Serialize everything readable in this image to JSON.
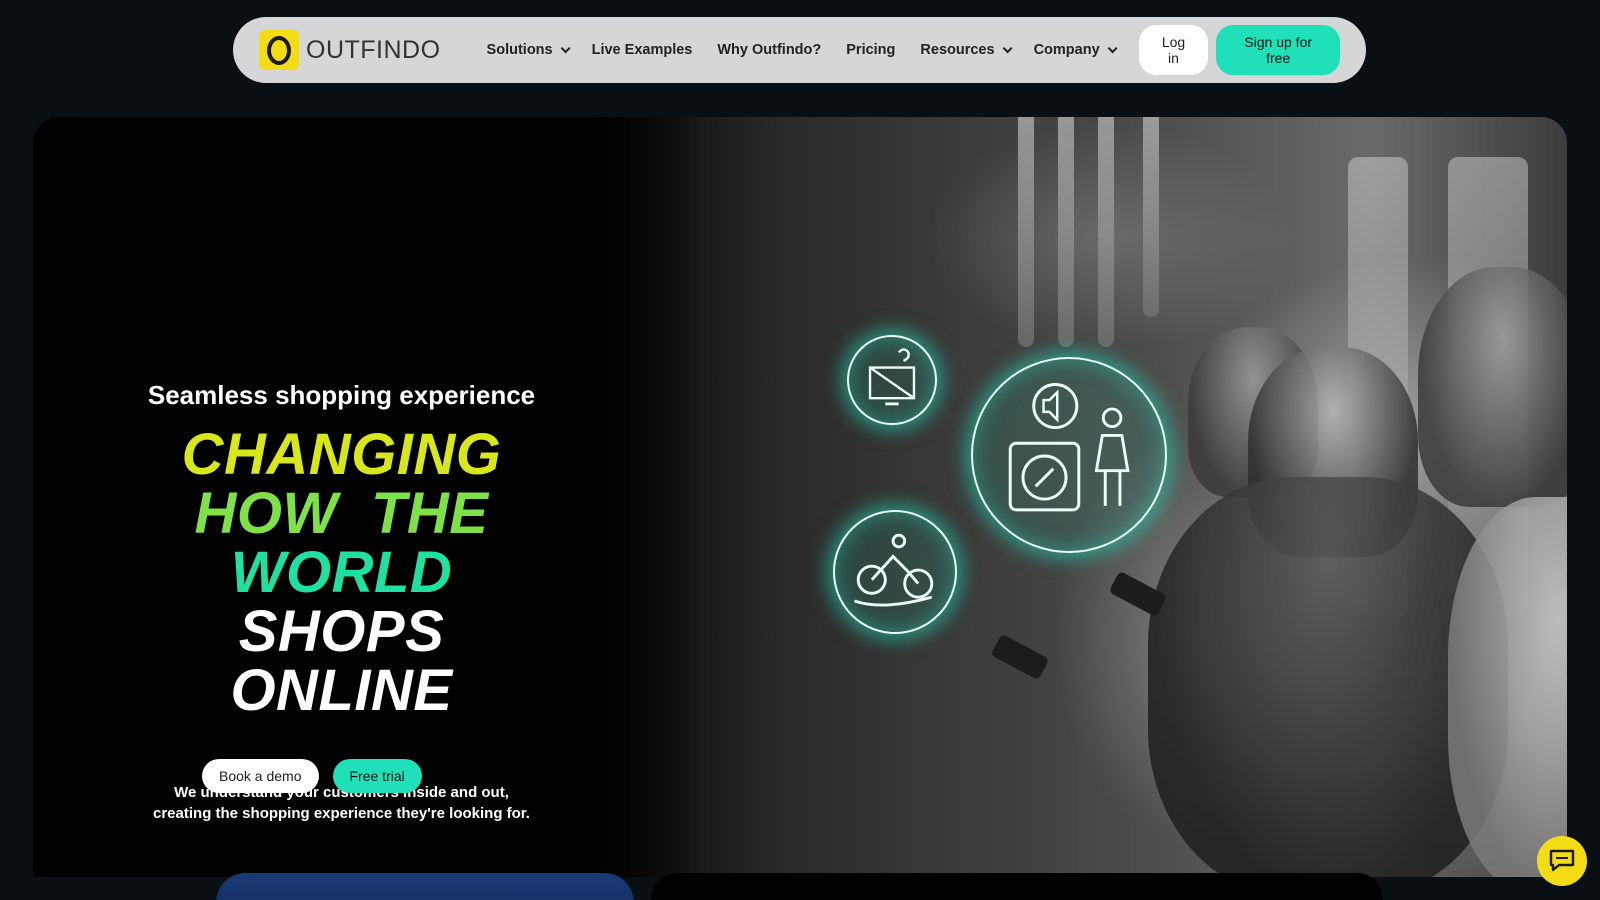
{
  "nav": {
    "logo_text": "OUTFINDO",
    "items": [
      {
        "label": "Solutions",
        "dropdown": true
      },
      {
        "label": "Live Examples",
        "dropdown": false
      },
      {
        "label": "Why Outfindo?",
        "dropdown": false
      },
      {
        "label": "Pricing",
        "dropdown": false
      },
      {
        "label": "Resources",
        "dropdown": true
      },
      {
        "label": "Company",
        "dropdown": true
      }
    ],
    "login_label": "Log in",
    "signup_label": "Sign up for free"
  },
  "hero": {
    "tagline": "Seamless shopping experience",
    "headline": [
      "CHANGING",
      "HOW  THE",
      "WORLD",
      "SHOPS",
      "ONLINE"
    ],
    "subtext_line1": "We understand your customers inside and out,",
    "subtext_line2": "creating the shopping experience they're looking for.",
    "demo_label": "Book a demo",
    "trial_label": "Free trial"
  },
  "colors": {
    "accent": "#1fe0b8",
    "brand_yellow": "#f3dc14",
    "headline_yellow": "#d8e61c",
    "headline_green": "#7fe04a",
    "headline_teal": "#1fe0a0"
  },
  "icons": [
    "monitor-question-icon",
    "mute-speaker-icon",
    "washing-machine-icon",
    "person-icon",
    "cyclist-icon",
    "chat-icon"
  ]
}
